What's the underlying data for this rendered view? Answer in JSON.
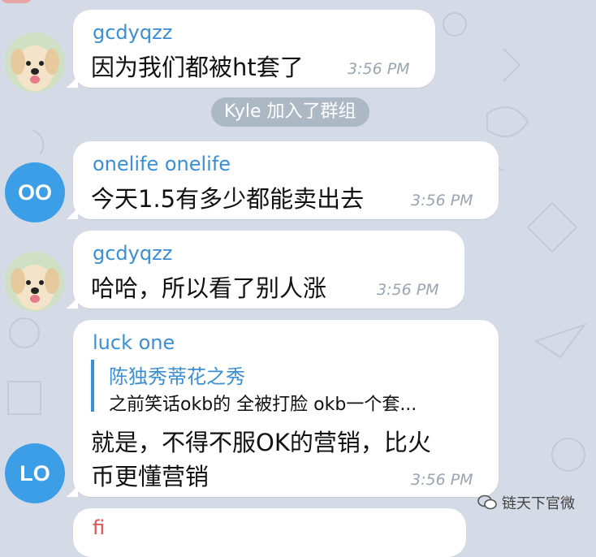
{
  "messages": [
    {
      "sender": "gcdyqzz",
      "text": "因为我们都被ht套了",
      "time": "3:56 PM"
    },
    {
      "sender": "onelife onelife",
      "text": "今天1.5有多少都能卖出去",
      "time": "3:56 PM",
      "avatar_initials": "OO"
    },
    {
      "sender": "gcdyqzz",
      "text": "哈哈，所以看了别人涨",
      "time": "3:56 PM"
    },
    {
      "sender": "luck one",
      "reply_author": "陈独秀蒂花之秀",
      "reply_text": "之前笑话okb的 全被打脸 okb一个套...",
      "text_line1": "就是，不得不服OK的营销，比火",
      "text_line2": "币更懂营销",
      "time": "3:56 PM",
      "avatar_initials": "LO"
    },
    {
      "sender_partial": "fi"
    }
  ],
  "service_message": "Kyle 加入了群组",
  "watermark": "链天下官微",
  "colors": {
    "background": "#d4dbe6",
    "accent": "#3a8fd5",
    "avatar_blue": "#3d9ee8"
  }
}
